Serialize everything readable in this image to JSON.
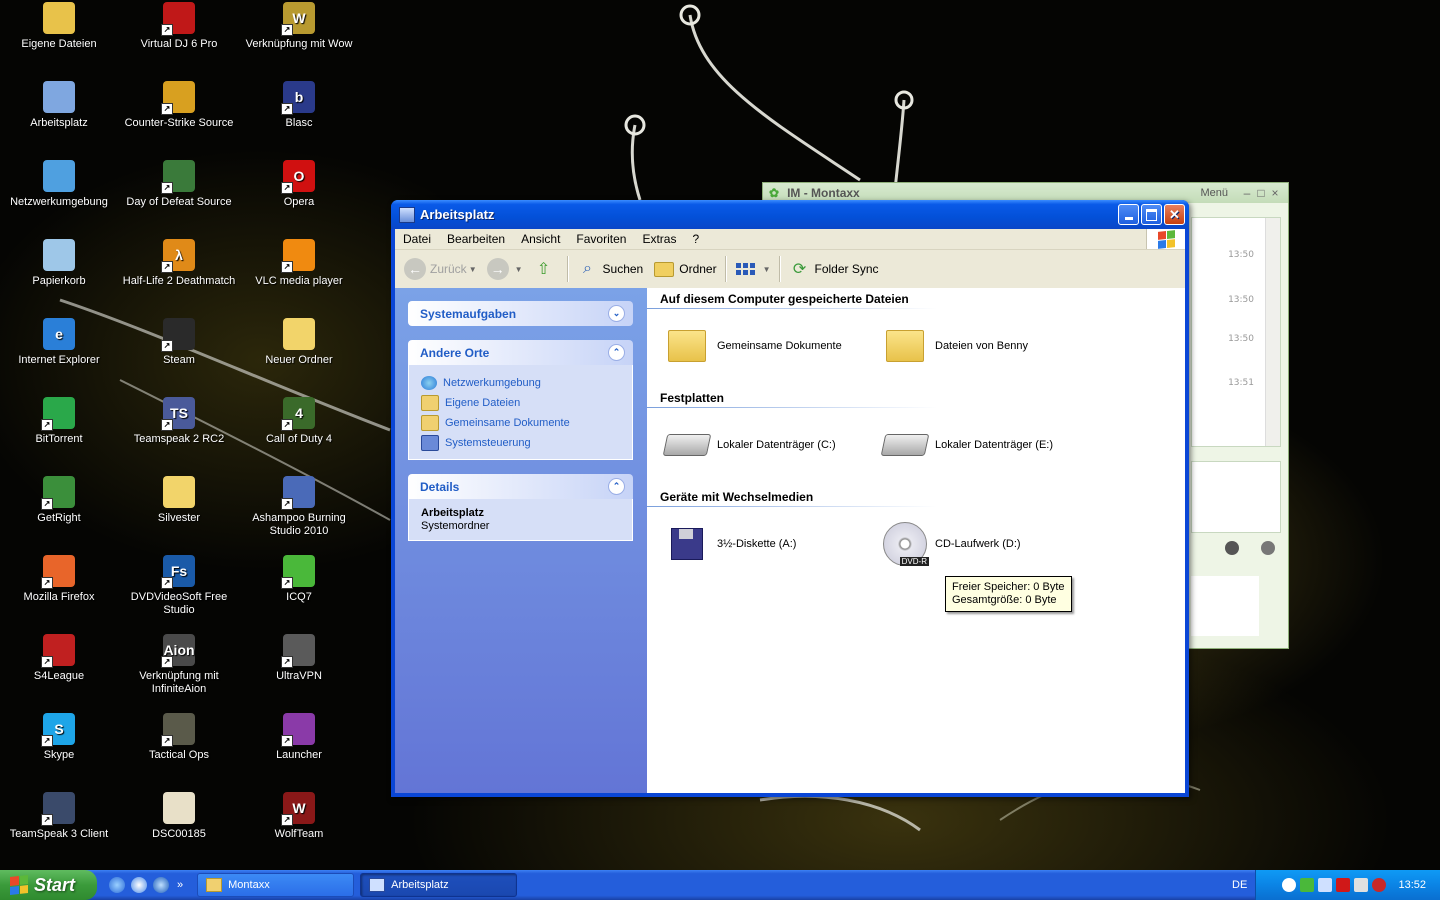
{
  "desktop": {
    "icons": [
      {
        "label": "Eigene Dateien",
        "icon": "my-documents-icon",
        "color": "#e8c24a",
        "glyph": "",
        "shortcut": false
      },
      {
        "label": "Arbeitsplatz",
        "icon": "my-computer-icon",
        "color": "#7fa7e0",
        "glyph": "",
        "shortcut": false
      },
      {
        "label": "Netzwerkumgebung",
        "icon": "network-icon",
        "color": "#4fa0e0",
        "glyph": "",
        "shortcut": false
      },
      {
        "label": "Papierkorb",
        "icon": "recycle-bin-icon",
        "color": "#9ec7e8",
        "glyph": "",
        "shortcut": false
      },
      {
        "label": "Internet Explorer",
        "icon": "internet-explorer-icon",
        "color": "#2a7fd8",
        "glyph": "e",
        "shortcut": false
      },
      {
        "label": "BitTorrent",
        "icon": "bittorrent-icon",
        "color": "#2aa84a",
        "glyph": "",
        "shortcut": true
      },
      {
        "label": "GetRight",
        "icon": "getright-icon",
        "color": "#3b8f3b",
        "glyph": "",
        "shortcut": true
      },
      {
        "label": "Mozilla Firefox",
        "icon": "firefox-icon",
        "color": "#e8652a",
        "glyph": "",
        "shortcut": true
      },
      {
        "label": "S4League",
        "icon": "s4league-icon",
        "color": "#c02020",
        "glyph": "",
        "shortcut": true
      },
      {
        "label": "Skype",
        "icon": "skype-icon",
        "color": "#1ea5e8",
        "glyph": "S",
        "shortcut": true
      },
      {
        "label": "TeamSpeak 3 Client",
        "icon": "teamspeak3-icon",
        "color": "#3a4a6a",
        "glyph": "",
        "shortcut": true
      },
      {
        "label": "Virtual DJ 6 Pro",
        "icon": "virtual-dj-icon",
        "color": "#c01818",
        "glyph": "",
        "shortcut": true
      },
      {
        "label": "Counter-Strike Source",
        "icon": "counter-strike-icon",
        "color": "#d8a020",
        "glyph": "",
        "shortcut": true
      },
      {
        "label": "Day of Defeat Source",
        "icon": "day-of-defeat-icon",
        "color": "#3a7a3a",
        "glyph": "",
        "shortcut": true
      },
      {
        "label": "Half-Life 2 Deathmatch",
        "icon": "half-life-icon",
        "color": "#e08a18",
        "glyph": "λ",
        "shortcut": true
      },
      {
        "label": "Steam",
        "icon": "steam-icon",
        "color": "#2a2a2a",
        "glyph": "",
        "shortcut": true
      },
      {
        "label": "Teamspeak 2 RC2",
        "icon": "teamspeak2-icon",
        "color": "#4a5a9a",
        "glyph": "TS",
        "shortcut": true
      },
      {
        "label": "Silvester",
        "icon": "folder-icon",
        "color": "#f2d46a",
        "glyph": "",
        "shortcut": false
      },
      {
        "label": "DVDVideoSoft Free Studio",
        "icon": "dvdvideosoft-icon",
        "color": "#1a5aa8",
        "glyph": "Fs",
        "shortcut": true
      },
      {
        "label": "Verknüpfung mit InfiniteAion",
        "icon": "aion-icon",
        "color": "#4a4a4a",
        "glyph": "Aion",
        "shortcut": true
      },
      {
        "label": "Tactical Ops",
        "icon": "tactical-ops-icon",
        "color": "#5a5a4a",
        "glyph": "",
        "shortcut": true
      },
      {
        "label": "DSC00185",
        "icon": "image-file-icon",
        "color": "#e8e0c8",
        "glyph": "",
        "shortcut": false
      },
      {
        "label": "Verknüpfung mit Wow",
        "icon": "wow-icon",
        "color": "#b89a30",
        "glyph": "W",
        "shortcut": true
      },
      {
        "label": "Blasc",
        "icon": "blasc-icon",
        "color": "#2a3a8a",
        "glyph": "b",
        "shortcut": true
      },
      {
        "label": "Opera",
        "icon": "opera-icon",
        "color": "#d01010",
        "glyph": "O",
        "shortcut": true
      },
      {
        "label": "VLC media player",
        "icon": "vlc-icon",
        "color": "#f08a10",
        "glyph": "",
        "shortcut": true
      },
      {
        "label": "Neuer Ordner",
        "icon": "folder-icon",
        "color": "#f2d46a",
        "glyph": "",
        "shortcut": false
      },
      {
        "label": "Call of Duty 4",
        "icon": "call-of-duty-icon",
        "color": "#3a6a2a",
        "glyph": "4",
        "shortcut": true
      },
      {
        "label": "Ashampoo Burning Studio 2010",
        "icon": "ashampoo-icon",
        "color": "#4a6ab8",
        "glyph": "",
        "shortcut": true
      },
      {
        "label": "ICQ7",
        "icon": "icq-icon",
        "color": "#4ab83a",
        "glyph": "",
        "shortcut": true
      },
      {
        "label": "UltraVPN",
        "icon": "ultravpn-icon",
        "color": "#5a5a5a",
        "glyph": "",
        "shortcut": true
      },
      {
        "label": "Launcher",
        "icon": "winrar-icon",
        "color": "#8a3aa8",
        "glyph": "",
        "shortcut": true
      },
      {
        "label": "WolfTeam",
        "icon": "wolfteam-icon",
        "color": "#8a1818",
        "glyph": "W",
        "shortcut": true
      }
    ]
  },
  "im_window": {
    "title": "IM - Montaxx",
    "menu": "Menü",
    "timestamps": [
      "13:50",
      "13:50",
      "13:50",
      "13:51"
    ]
  },
  "explorer": {
    "title": "Arbeitsplatz",
    "menu": [
      "Datei",
      "Bearbeiten",
      "Ansicht",
      "Favoriten",
      "Extras",
      "?"
    ],
    "toolbar": {
      "back": "Zurück",
      "search": "Suchen",
      "folders": "Ordner",
      "folder_sync": "Folder Sync"
    },
    "taskpane": {
      "system_tasks": "Systemaufgaben",
      "other_places": "Andere Orte",
      "other_places_links": [
        "Netzwerkumgebung",
        "Eigene Dateien",
        "Gemeinsame Dokumente",
        "Systemsteuerung"
      ],
      "details": "Details",
      "details_title": "Arbeitsplatz",
      "details_sub": "Systemordner"
    },
    "groups": {
      "stored_files": "Auf diesem Computer gespeicherte Dateien",
      "hard_disks": "Festplatten",
      "removable": "Geräte mit Wechselmedien"
    },
    "items": {
      "shared_docs": "Gemeinsame Dokumente",
      "benny_files": "Dateien von Benny",
      "drive_c": "Lokaler Datenträger (C:)",
      "drive_e": "Lokaler Datenträger (E:)",
      "floppy": "3½-Diskette (A:)",
      "cd_drive": "CD-Laufwerk (D:)",
      "dvd_badge": "DVD-R"
    },
    "tooltip": {
      "free": "Freier Speicher: 0 Byte",
      "total": "Gesamtgröße: 0 Byte"
    }
  },
  "taskbar": {
    "start": "Start",
    "buttons": [
      "Montaxx",
      "Arbeitsplatz"
    ],
    "language": "DE",
    "clock": "13:52"
  }
}
